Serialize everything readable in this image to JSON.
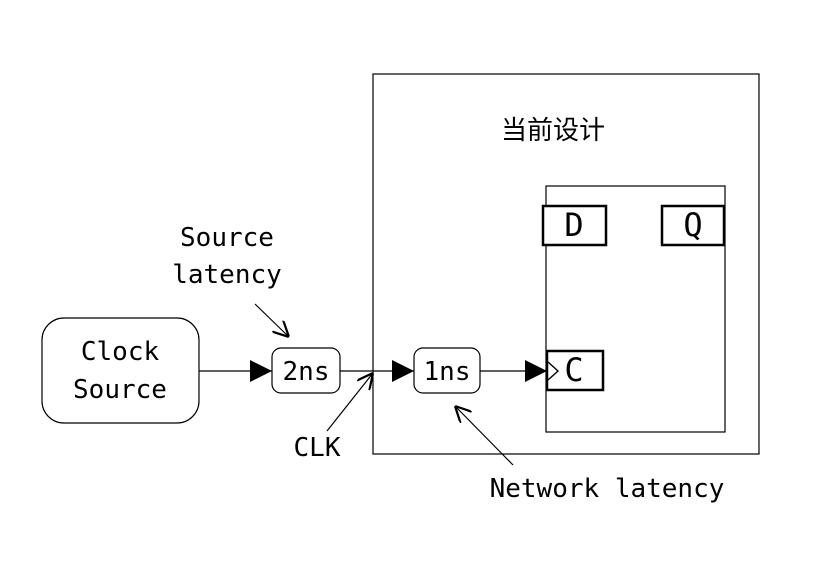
{
  "diagram": {
    "design_title": "当前设计",
    "clock_source": {
      "line1": "Clock",
      "line2": "Source"
    },
    "source_latency": {
      "value": "2ns",
      "label_line1": "Source",
      "label_line2": "latency"
    },
    "network_latency": {
      "value": "1ns",
      "label": "Network latency"
    },
    "clk_label": "CLK",
    "flipflop": {
      "d_pin": "D",
      "q_pin": "Q",
      "c_pin": "C"
    }
  }
}
